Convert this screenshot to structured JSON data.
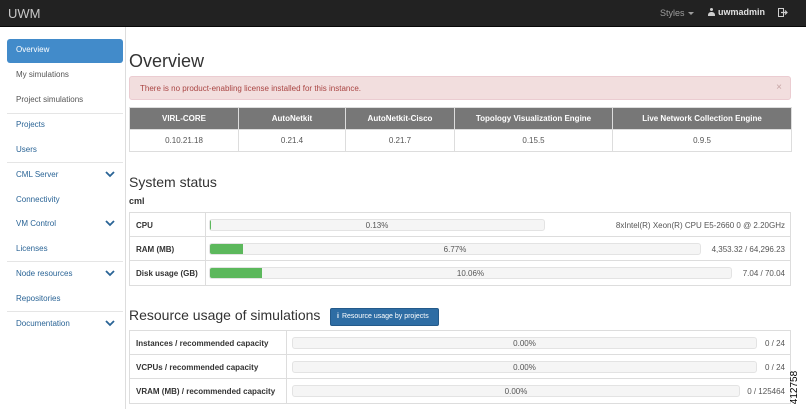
{
  "topbar": {
    "brand": "UWM",
    "styles_label": "Styles",
    "username": "uwmadmin",
    "logout_icon": "sign-out-icon",
    "colors": {
      "background": "#222222"
    }
  },
  "sidebar": {
    "items": [
      {
        "label": "Overview",
        "active": true
      },
      {
        "label": "My simulations"
      },
      {
        "label": "Project simulations"
      },
      {
        "label": "Projects"
      },
      {
        "label": "Users"
      },
      {
        "label": "CML Server",
        "expandable": true
      },
      {
        "label": "Connectivity"
      },
      {
        "label": "VM Control",
        "expandable": true
      },
      {
        "label": "Licenses"
      },
      {
        "label": "Node resources",
        "expandable": true
      },
      {
        "label": "Repositories"
      },
      {
        "label": "Documentation",
        "expandable": true
      }
    ],
    "colors": {
      "active_bg": "#428bca",
      "link": "#2a6496"
    }
  },
  "main": {
    "title": "Overview",
    "alert": {
      "text": "There is no product-enabling license installed for this instance.",
      "close": "×"
    },
    "versions": {
      "headers": [
        "VIRL-CORE",
        "AutoNetkit",
        "AutoNetkit-Cisco",
        "Topology Visualization Engine",
        "Live Network Collection Engine"
      ],
      "values": [
        "0.10.21.18",
        "0.21.4",
        "0.21.7",
        "0.15.5",
        "0.9.5"
      ]
    },
    "system_status": {
      "title": "System status",
      "host": "cml",
      "rows": [
        {
          "label": "CPU",
          "percent_text": "0.13%",
          "percent": 0.13,
          "info": "8xIntel(R) Xeon(R) CPU E5-2660 0 @ 2.20GHz"
        },
        {
          "label": "RAM (MB)",
          "percent_text": "6.77%",
          "percent": 6.77,
          "info": "4,353.32 / 64,296.23"
        },
        {
          "label": "Disk usage (GB)",
          "percent_text": "10.06%",
          "percent": 10.06,
          "info": "7.04 / 70.04"
        }
      ]
    },
    "resource_usage": {
      "title": "Resource usage of simulations",
      "button_label": "Resource usage by projects",
      "rows": [
        {
          "label": "Instances / recommended capacity",
          "percent_text": "0.00%",
          "percent": 0,
          "info": "0 / 24"
        },
        {
          "label": "VCPUs / recommended capacity",
          "percent_text": "0.00%",
          "percent": 0,
          "info": "0 / 24"
        },
        {
          "label": "VRAM (MB) / recommended capacity",
          "percent_text": "0.00%",
          "percent": 0,
          "info": "0 / 125464"
        }
      ]
    },
    "colors": {
      "progress": "#5cb85c",
      "alert_bg": "#f2dede",
      "alert_text": "#a94442",
      "table_header": "#777777"
    }
  },
  "figure_id": "412758"
}
